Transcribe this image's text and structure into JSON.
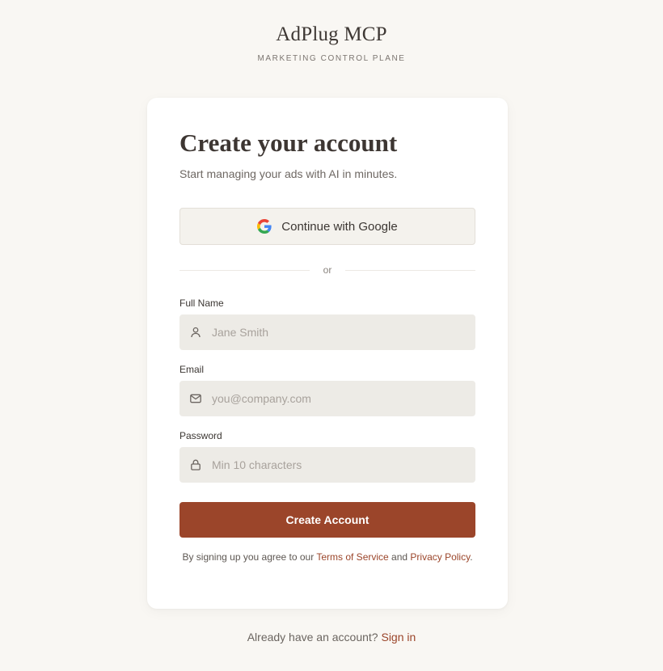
{
  "brand": {
    "name": "AdPlug MCP",
    "tagline": "MARKETING CONTROL PLANE"
  },
  "card": {
    "title": "Create your account",
    "subtitle": "Start managing your ads with AI in minutes.",
    "google_button_label": "Continue with Google",
    "divider_text": "or",
    "fields": {
      "full_name": {
        "label": "Full Name",
        "placeholder": "Jane Smith",
        "value": "",
        "icon": "user-icon"
      },
      "email": {
        "label": "Email",
        "placeholder": "you@company.com",
        "value": "",
        "icon": "mail-icon"
      },
      "password": {
        "label": "Password",
        "placeholder": "Min 10 characters",
        "value": "",
        "icon": "lock-icon"
      }
    },
    "submit_label": "Create Account",
    "legal": {
      "prefix": "By signing up you agree to our ",
      "terms_link": "Terms of Service",
      "middle": " and ",
      "privacy_link": "Privacy Policy",
      "suffix": "."
    }
  },
  "footer": {
    "prompt": "Already have an account? ",
    "signin_link": "Sign in"
  },
  "colors": {
    "background": "#f9f7f3",
    "card": "#ffffff",
    "accent": "#9b452a",
    "input_bg": "#edebe6"
  }
}
